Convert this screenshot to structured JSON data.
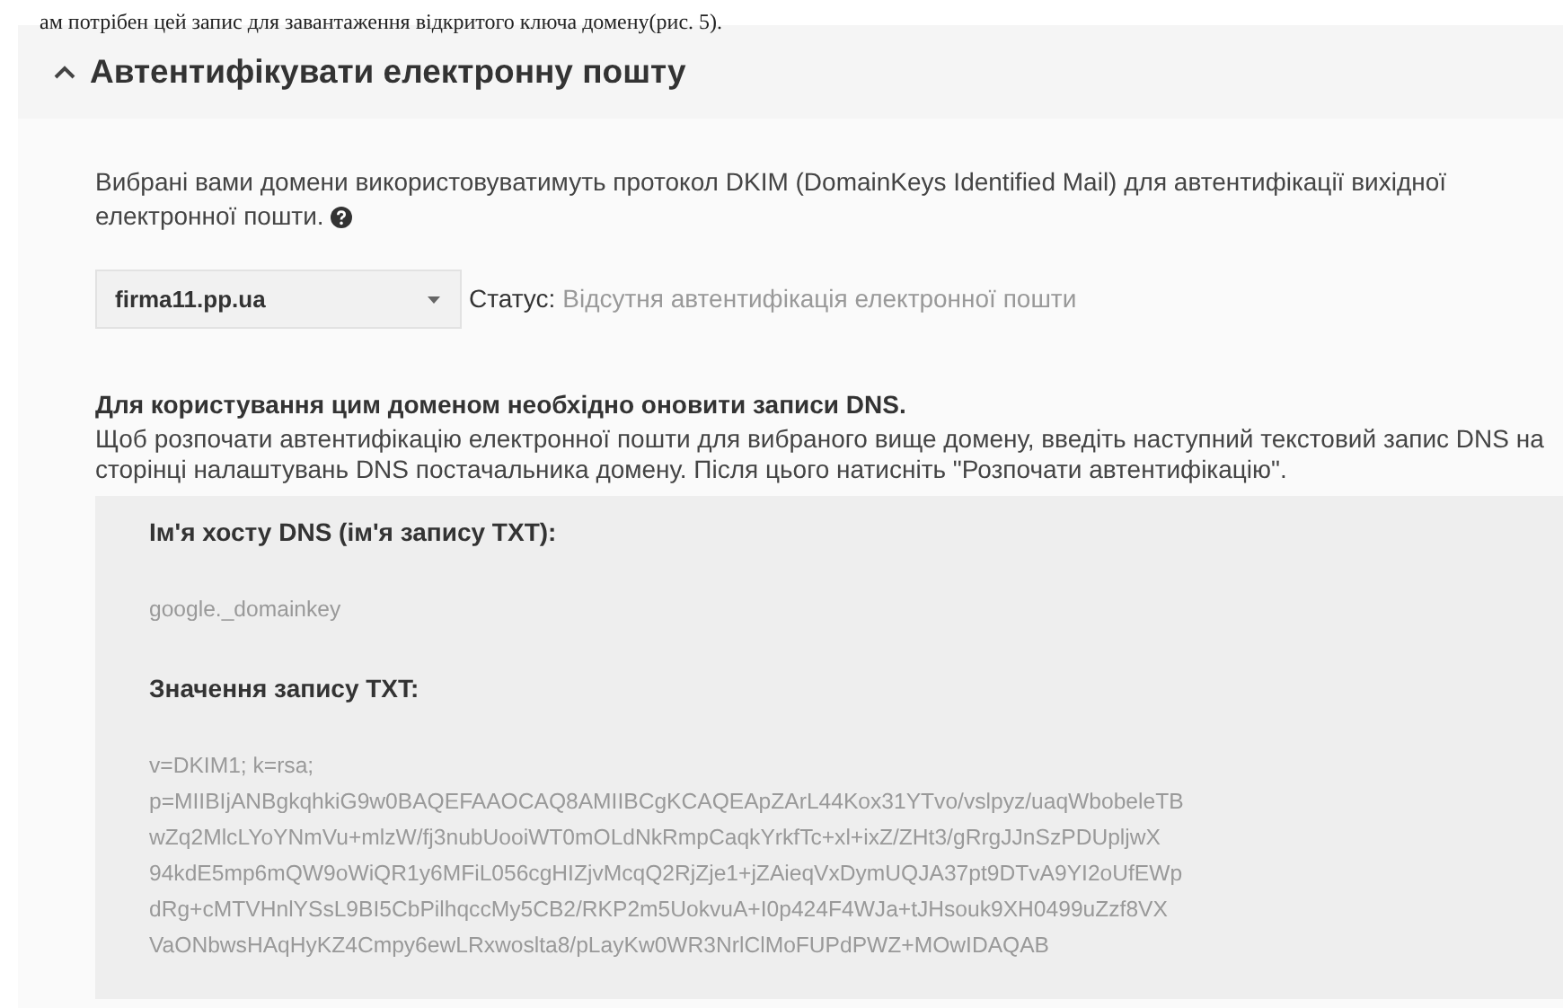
{
  "document_text": "ам потрібен цей запис для завантаження відкритого ключа домену(рис. 5).",
  "section": {
    "title": "Автентифікувати електронну пошту",
    "expanded": true,
    "description": "Вибрані вами домени використовуватимуть протокол DKIM (DomainKeys Identified Mail) для автентифікації вихідної електронної пошти.",
    "domain_select": {
      "value": "firma11.pp.ua"
    },
    "status_label": "Статус:",
    "status_value": "Відсутня автентифікація електронної пошти",
    "dns_notice_title": "Для користування цим доменом необхідно оновити записи DNS.",
    "dns_notice_text": "Щоб розпочати автентифікацію електронної пошти для вибраного вище домену, введіть наступний текстовий запис DNS на сторінці налаштувань DNS постачальника домену. Після цього натисніть \"Розпочати автентифікацію\".",
    "records": [
      {
        "label": "Ім'я хосту DNS (ім'я запису TXT):",
        "value_lines": [
          "google._domainkey"
        ]
      },
      {
        "label": "Значення запису TXT:",
        "value_lines": [
          "v=DKIM1; k=rsa;",
          "p=MIIBIjANBgkqhkiG9w0BAQEFAAOCAQ8AMIIBCgKCAQEApZArL44Kox31YTvo/vslpyz/uaqWbobeleTB",
          "wZq2MlcLYoYNmVu+mlzW/fj3nubUooiWT0mOLdNkRmpCaqkYrkfTc+xl+ixZ/ZHt3/gRrgJJnSzPDUpljwX",
          "94kdE5mp6mQW9oWiQR1y6MFiL056cgHIZjvMcqQ2RjZje1+jZAieqVxDymUQJA37pt9DTvA9YI2oUfEWp",
          "dRg+cMTVHnlYSsL9BI5CbPilhqccMy5CB2/RKP2m5UokvuA+I0p424F4WJa+tJHsouk9XH0499uZzf8VX",
          "VaONbwsHAqHyKZ4Cmpy6ewLRxwoslta8/pLayKw0WR3NrlClMoFUPdPWZ+MOwIDAQAB"
        ]
      }
    ]
  }
}
